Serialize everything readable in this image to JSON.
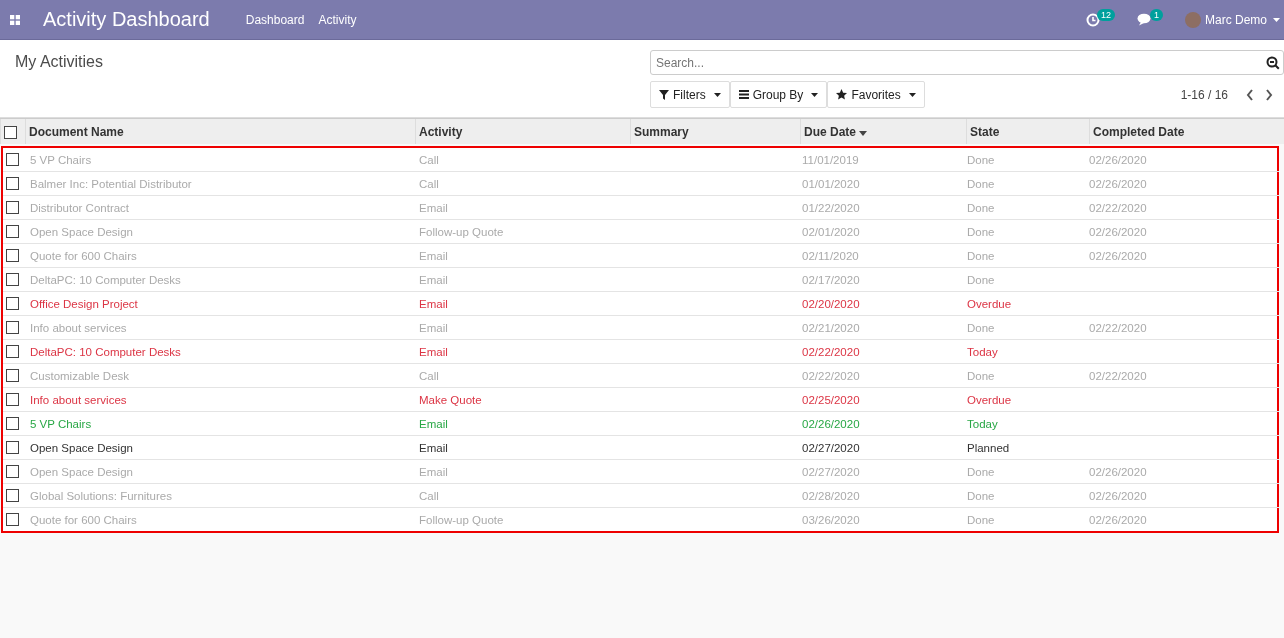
{
  "navbar": {
    "title": "Activity Dashboard",
    "menu": [
      "Dashboard",
      "Activity"
    ],
    "activity_badge": "12",
    "message_badge": "1",
    "user": "Marc Demo"
  },
  "control_panel": {
    "breadcrumb": "My Activities",
    "search": {
      "placeholder": "Search..."
    },
    "buttons": [
      "Filters",
      "Group By",
      "Favorites"
    ],
    "pager": "1-16 / 16"
  },
  "table": {
    "select_all": {
      "checked": false
    },
    "columns": [
      {
        "label": "Document Name",
        "sorted": false
      },
      {
        "label": "Activity",
        "sorted": false
      },
      {
        "label": "Summary",
        "sorted": false
      },
      {
        "label": "Due Date",
        "sorted": true
      },
      {
        "label": "State",
        "sorted": false
      },
      {
        "label": "Completed Date",
        "sorted": false
      }
    ],
    "rows": [
      {
        "document": "5 VP Chairs",
        "activity": "Call",
        "due": "11/01/2019",
        "state": "Done",
        "completed": "02/26/2020",
        "color": "#aaaaaa",
        "checked": false
      },
      {
        "document": "Balmer Inc: Potential Distributor",
        "activity": "Call",
        "due": "01/01/2020",
        "state": "Done",
        "completed": "02/26/2020",
        "color": "#aaaaaa",
        "checked": false
      },
      {
        "document": "Distributor Contract",
        "activity": "Email",
        "due": "01/22/2020",
        "state": "Done",
        "completed": "02/22/2020",
        "color": "#aaaaaa",
        "checked": false
      },
      {
        "document": "Open Space Design",
        "activity": "Follow-up Quote",
        "due": "02/01/2020",
        "state": "Done",
        "completed": "02/26/2020",
        "color": "#aaaaaa",
        "checked": false
      },
      {
        "document": "Quote for 600 Chairs",
        "activity": "Email",
        "due": "02/11/2020",
        "state": "Done",
        "completed": "02/26/2020",
        "color": "#aaaaaa",
        "checked": false
      },
      {
        "document": "DeltaPC: 10 Computer Desks",
        "activity": "Email",
        "due": "02/17/2020",
        "state": "Done",
        "color": "#aaaaaa",
        "checked": false
      },
      {
        "document": "Office Design Project",
        "activity": "Email",
        "due": "02/20/2020",
        "state": "Overdue",
        "color": "#dc3545",
        "checked": false
      },
      {
        "document": "Info about services",
        "activity": "Email",
        "due": "02/21/2020",
        "state": "Done",
        "completed": "02/22/2020",
        "color": "#aaaaaa",
        "checked": false
      },
      {
        "document": "DeltaPC: 10 Computer Desks",
        "activity": "Email",
        "due": "02/22/2020",
        "state": "Today",
        "color": "#dc3545",
        "checked": false
      },
      {
        "document": "Customizable Desk",
        "activity": "Call",
        "due": "02/22/2020",
        "state": "Done",
        "completed": "02/22/2020",
        "color": "#aaaaaa",
        "checked": false
      },
      {
        "document": "Info about services",
        "activity": "Make Quote",
        "due": "02/25/2020",
        "state": "Overdue",
        "color": "#dc3545",
        "checked": false
      },
      {
        "document": "5 VP Chairs",
        "activity": "Email",
        "due": "02/26/2020",
        "state": "Today",
        "color": "#28a745",
        "checked": false
      },
      {
        "document": "Open Space Design",
        "activity": "Email",
        "due": "02/27/2020",
        "state": "Planned",
        "color": "#333333",
        "checked": false
      },
      {
        "document": "Open Space Design",
        "activity": "Email",
        "due": "02/27/2020",
        "state": "Done",
        "completed": "02/26/2020",
        "color": "#aaaaaa",
        "checked": false
      },
      {
        "document": "Global Solutions: Furnitures",
        "activity": "Call",
        "due": "02/28/2020",
        "state": "Done",
        "completed": "02/26/2020",
        "color": "#aaaaaa",
        "checked": false
      },
      {
        "document": "Quote for 600 Chairs",
        "activity": "Follow-up Quote",
        "due": "03/26/2020",
        "state": "Done",
        "completed": "02/26/2020",
        "color": "#aaaaaa",
        "checked": false
      }
    ]
  }
}
